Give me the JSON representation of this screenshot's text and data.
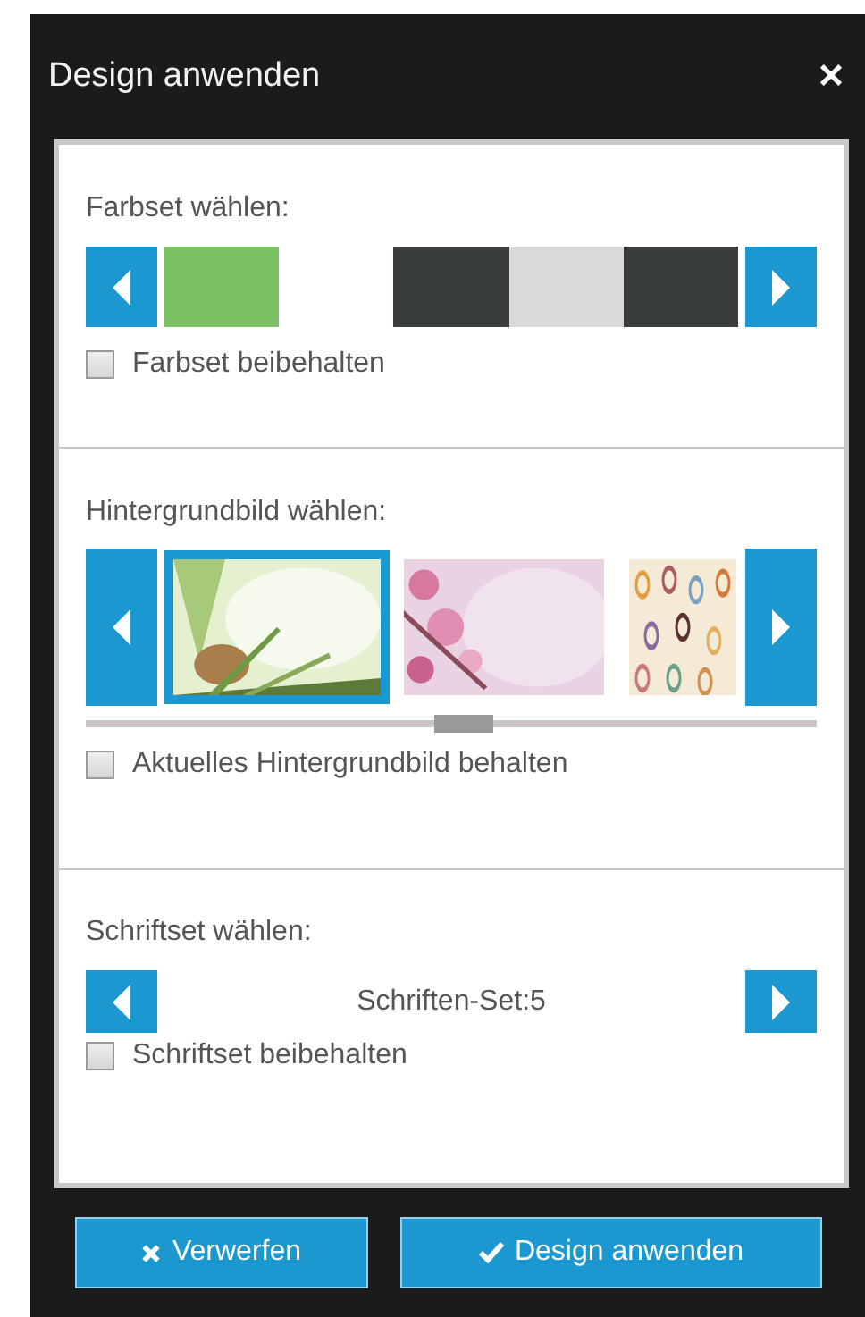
{
  "dialog": {
    "title": "Design anwenden",
    "close": "×"
  },
  "color_section": {
    "label": "Farbset wählen:",
    "swatches": [
      {
        "color": "#7dc165"
      },
      {
        "color": "#ffffff"
      },
      {
        "color": "#3a3d3e"
      },
      {
        "color": "#d9d9d9"
      },
      {
        "color": "#3a3d3e"
      }
    ],
    "keep": {
      "label": "Farbset beibehalten",
      "checked": false
    }
  },
  "image_section": {
    "label": "Hintergrundbild wählen:",
    "images": [
      {
        "kind": "picture",
        "selected": true
      },
      {
        "kind": "picture",
        "selected": false
      },
      {
        "kind": "picture",
        "selected": false
      }
    ],
    "keep": {
      "label": "Aktuelles Hintergrundbild behalten",
      "checked": false
    }
  },
  "font_section": {
    "label": "Schriftset wählen:",
    "value": "Schriften-Set:5",
    "keep": {
      "label": "Schriftset beibehalten",
      "checked": false
    }
  },
  "buttons": [
    {
      "kind": "discard",
      "label": "Verwerfen"
    },
    {
      "kind": "apply",
      "label": "Design anwenden"
    }
  ]
}
